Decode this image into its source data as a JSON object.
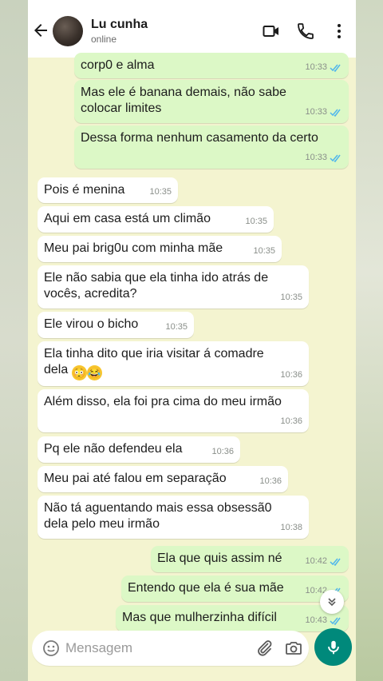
{
  "header": {
    "contact_name": "Lu cunha",
    "status": "online"
  },
  "messages": [
    {
      "dir": "out",
      "text": "corp0 e alma",
      "time": "10:33",
      "read": true
    },
    {
      "dir": "out",
      "text": "Mas ele é banana demais, não sabe\ncolocar limites",
      "time": "10:33",
      "read": true
    },
    {
      "dir": "out",
      "text": "Dessa forma nenhum casamento da certo",
      "time": "10:33",
      "read": true
    },
    {
      "dir": "in",
      "text": "Pois é menina",
      "time": "10:35"
    },
    {
      "dir": "in",
      "text": "Aqui em casa está um climão",
      "time": "10:35"
    },
    {
      "dir": "in",
      "text": "Meu pai brig0u com minha mãe",
      "time": "10:35"
    },
    {
      "dir": "in",
      "text": "Ele não sabia que ela tinha ido atrás de\nvocês, acredita?",
      "time": "10:35"
    },
    {
      "dir": "in",
      "text": "Ele virou o bicho",
      "time": "10:35"
    },
    {
      "dir": "in",
      "text": "Ela tinha dito que iria visitar á comadre\ndela",
      "time": "10:36",
      "emojis": [
        "😳",
        "😂"
      ]
    },
    {
      "dir": "in",
      "text": "Além disso, ela foi pra cima do meu irmão",
      "time": "10:36"
    },
    {
      "dir": "in",
      "text": "Pq ele não defendeu ela",
      "time": "10:36"
    },
    {
      "dir": "in",
      "text": "Meu pai até falou em separação",
      "time": "10:36"
    },
    {
      "dir": "in",
      "text": "Não tá aguentando mais essa obsessã0\ndela pelo meu irmão",
      "time": "10:38"
    },
    {
      "dir": "out",
      "text": "Ela que quis assim né",
      "time": "10:42",
      "read": true
    },
    {
      "dir": "out",
      "text": "Entendo que ela é sua mãe",
      "time": "10:42",
      "read": true
    },
    {
      "dir": "out",
      "text": "Mas que mulherzinha difícil",
      "time": "10:43",
      "read": true
    }
  ],
  "input": {
    "placeholder": "Mensagem"
  },
  "colors": {
    "outgoing_bubble": "#dcf8c6",
    "incoming_bubble": "#ffffff",
    "chat_background": "#f4f4d0",
    "accent": "#00897b",
    "read_ticks": "#4fb6ec"
  },
  "icons": [
    "back-arrow-icon",
    "video-call-icon",
    "phone-icon",
    "more-vert-icon",
    "emoji-icon",
    "attach-icon",
    "camera-icon",
    "mic-icon",
    "chevron-down-icon"
  ]
}
